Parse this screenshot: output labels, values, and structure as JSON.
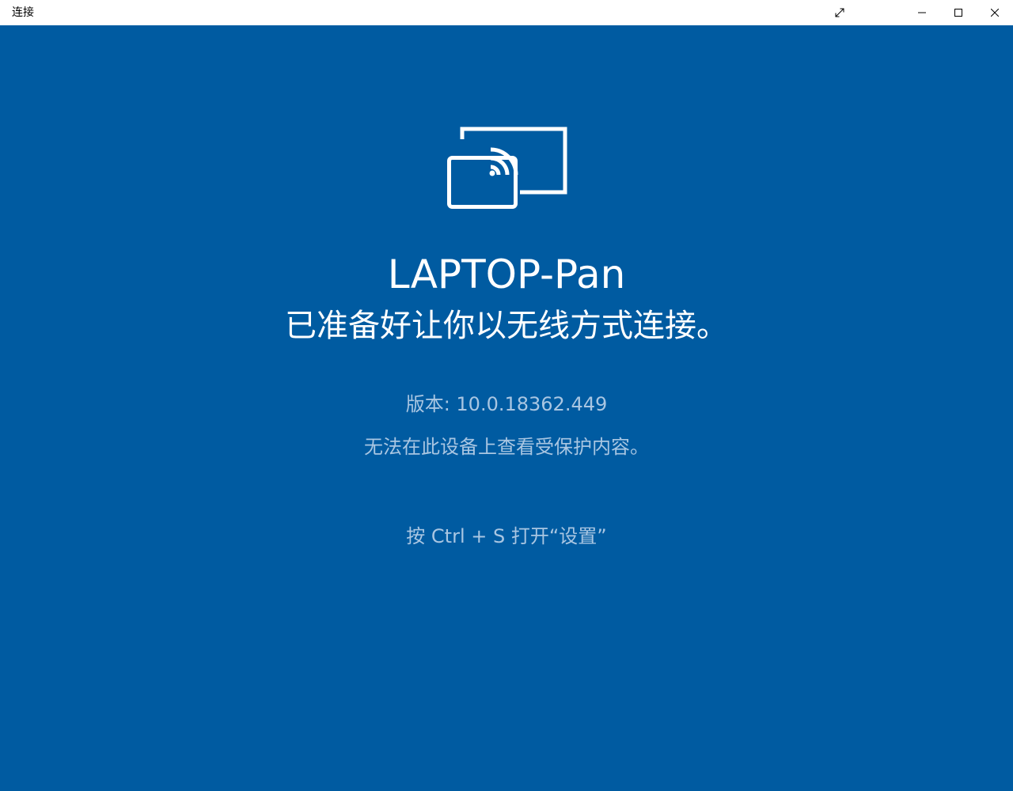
{
  "window": {
    "title": "连接",
    "background_color": "#005ba1",
    "titlebar_color": "#ffffff",
    "controls": {
      "fullscreen_icon": "expand-arrows-icon",
      "minimize_icon": "minimize-icon",
      "maximize_icon": "maximize-icon",
      "close_icon": "close-icon"
    }
  },
  "main": {
    "icon": "wireless-display-cast-icon",
    "device_name": "LAPTOP-Pan",
    "ready_text": "已准备好让你以无线方式连接。",
    "version": "版本: 10.0.18362.449",
    "protected_content": "无法在此设备上查看受保护内容。",
    "settings_hint": "按 Ctrl + S 打开“设置”",
    "text_secondary_color": "#a9c6e2"
  }
}
